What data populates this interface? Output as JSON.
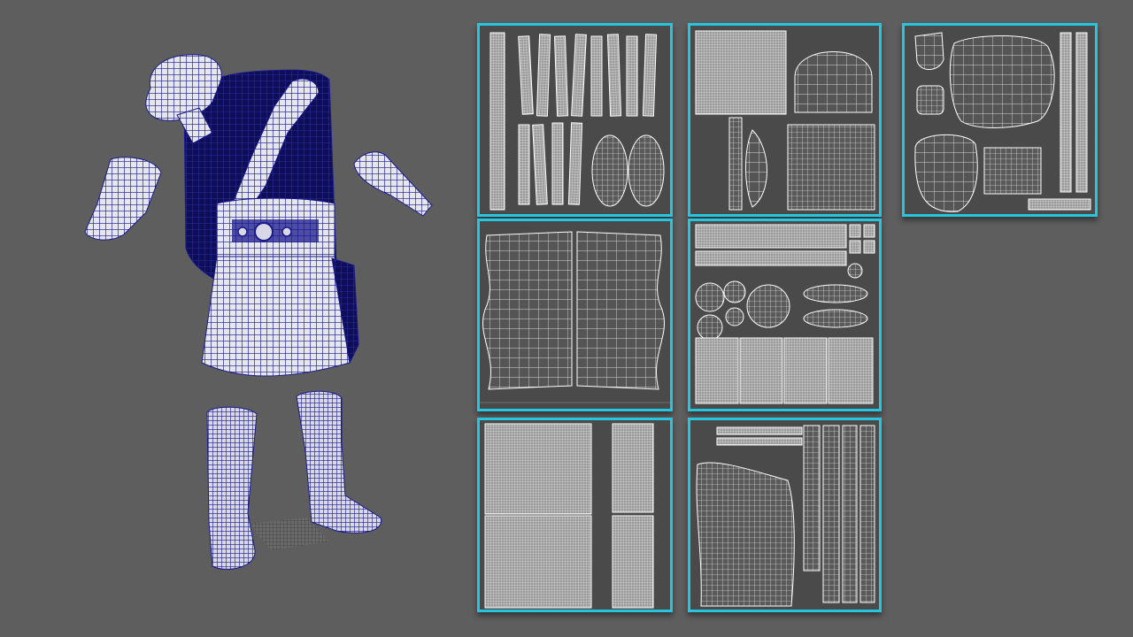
{
  "scene": {
    "background_color": "#5e5e5e",
    "wireframe_color": "#1a1a8c",
    "panel_border_color": "#27c6e0",
    "uv_line_color": "#f2f2f2"
  },
  "model": {
    "parts": [
      "head-wrap",
      "torso-drape",
      "shoulder-strap",
      "belt",
      "skirt",
      "left-bracer",
      "right-bracer",
      "left-boot",
      "right-boot",
      "ground-patch"
    ]
  },
  "uv_panels": [
    {
      "id": "strips-and-soles"
    },
    {
      "id": "cap-and-blocks"
    },
    {
      "id": "head-pieces"
    },
    {
      "id": "skirt-halves"
    },
    {
      "id": "belt-and-discs"
    },
    {
      "id": "large-grids"
    },
    {
      "id": "drape-and-strips"
    }
  ]
}
